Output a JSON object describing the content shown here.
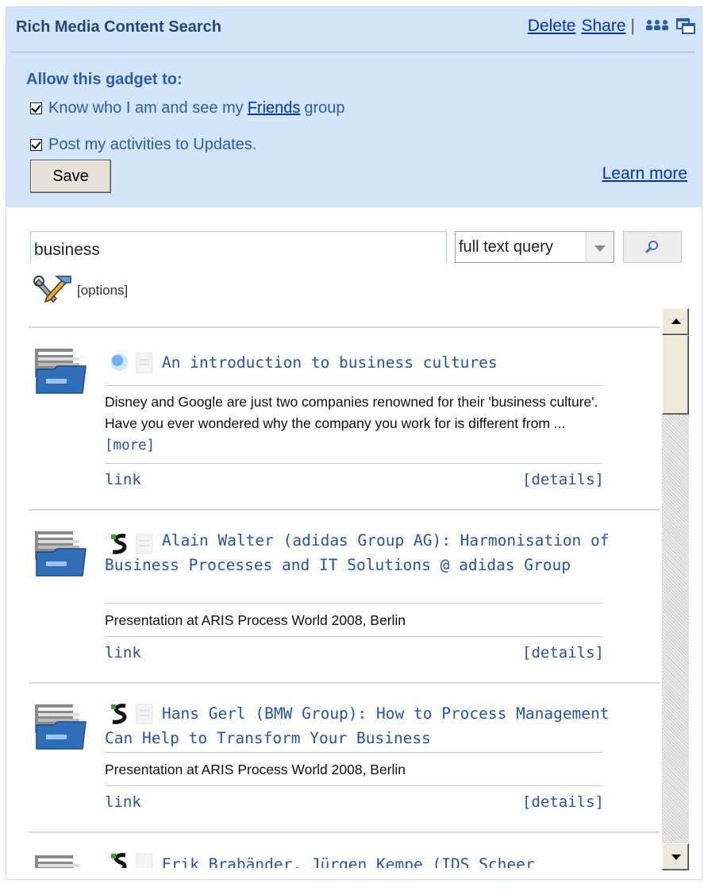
{
  "header": {
    "title": "Rich Media Content Search",
    "delete_label": "Delete",
    "share_label": "Share",
    "separator": "|",
    "icons": [
      "people-icon",
      "popout-icon"
    ]
  },
  "permissions": {
    "heading": "Allow this gadget to:",
    "items": [
      {
        "before": "Know who I am and see my",
        "link": "Friends",
        "after": "group",
        "checked": true
      },
      {
        "text": "Post my activities to Updates.",
        "checked": true
      }
    ],
    "save_label": "Save",
    "learn_more_label": "Learn more"
  },
  "search": {
    "query": "business",
    "mode": "full text query",
    "search_icon": "magnifier-icon",
    "options_label": "[options]",
    "options_icon": "tools-icon"
  },
  "results": [
    {
      "title": "An introduction to business cultures",
      "source_icon": "globe-icon",
      "description": "Disney and Google are just two companies renowned for their 'business culture'. Have you ever wondered why the company you work for is different from ...",
      "more_label": "[more]",
      "link_label": "link",
      "details_label": "[details]"
    },
    {
      "title": "Alain Walter (adidas Group AG): Harmonisation of Business Processes and IT Solutions @ adidas Group",
      "source_icon": "slideshare-icon",
      "description": "Presentation at ARIS Process World 2008, Berlin",
      "link_label": "link",
      "details_label": "[details]"
    },
    {
      "title": "Hans Gerl (BMW Group): How to Process Management Can Help to Transform Your Business",
      "source_icon": "slideshare-icon",
      "description": "Presentation at ARIS Process World 2008, Berlin",
      "link_label": "link",
      "details_label": "[details]"
    },
    {
      "title": "Erik Brabänder, Jürgen Kempe (IDS Scheer",
      "source_icon": "slideshare-icon"
    }
  ]
}
